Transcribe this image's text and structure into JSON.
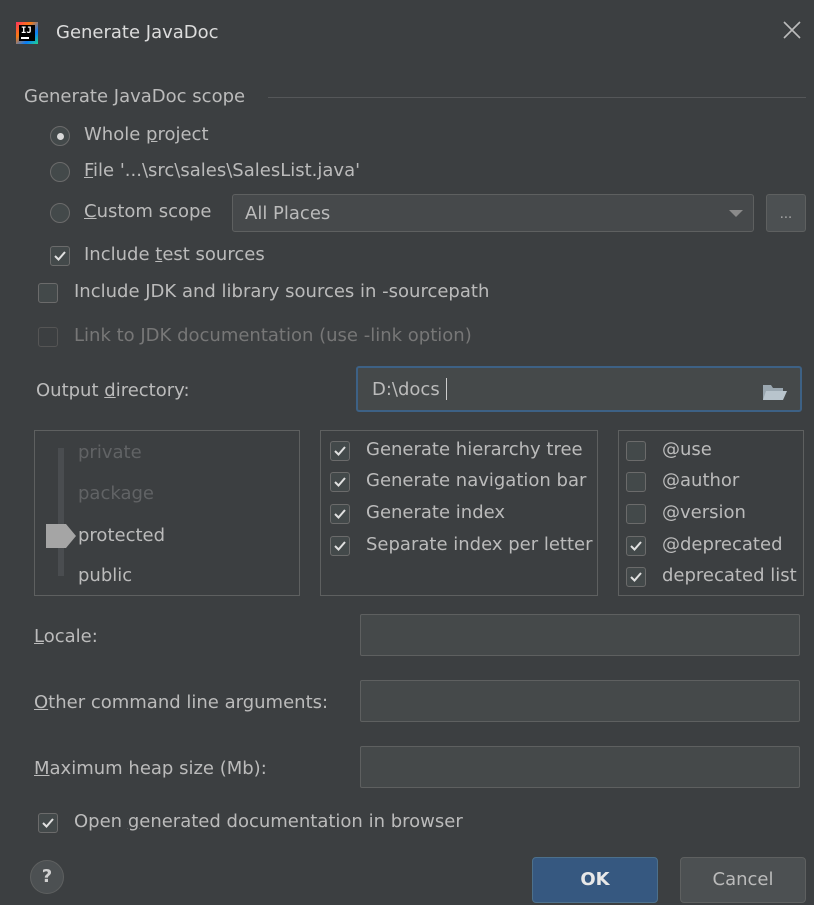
{
  "window": {
    "title": "Generate JavaDoc"
  },
  "scope": {
    "title": "Generate JavaDoc scope",
    "whole_project": {
      "pre": "Whole ",
      "key": "p",
      "post": "roject"
    },
    "file": {
      "key": "F",
      "post": "ile '...\\src\\sales\\SalesList.java'"
    },
    "custom": {
      "key": "C",
      "post": "ustom scope"
    },
    "custom_value": "All Places",
    "browse_label": "...",
    "include_test": {
      "pre": "Include ",
      "key": "t",
      "post": "est sources"
    },
    "include_jdk": "Include JDK and library sources in -sourcepath",
    "link_jdk": "Link to JDK documentation (use -link option)"
  },
  "output": {
    "label_pre": "Output ",
    "label_key": "d",
    "label_post": "irectory:",
    "value": "D:\\docs"
  },
  "visibility": {
    "levels": [
      "private",
      "package",
      "protected",
      "public"
    ],
    "selected": "protected"
  },
  "options": {
    "hierarchy": "Generate hierarchy tree",
    "navigation": "Generate navigation bar",
    "index": "Generate index",
    "separate": "Separate index per letter"
  },
  "tags": {
    "use": "@use",
    "author": "@author",
    "version": "@version",
    "deprecated": "@deprecated",
    "deprecated_list": "deprecated list"
  },
  "fields": {
    "locale": {
      "key": "L",
      "post": "ocale:",
      "value": ""
    },
    "other": {
      "key": "O",
      "post": "ther command line arguments:",
      "value": ""
    },
    "heap": {
      "key": "M",
      "post": "aximum heap size (Mb):",
      "value": ""
    }
  },
  "open_browser": {
    "pre": "Open ",
    "key": "g",
    "post": "enerated documentation in browser"
  },
  "buttons": {
    "ok": "OK",
    "cancel": "Cancel",
    "help": "?"
  }
}
